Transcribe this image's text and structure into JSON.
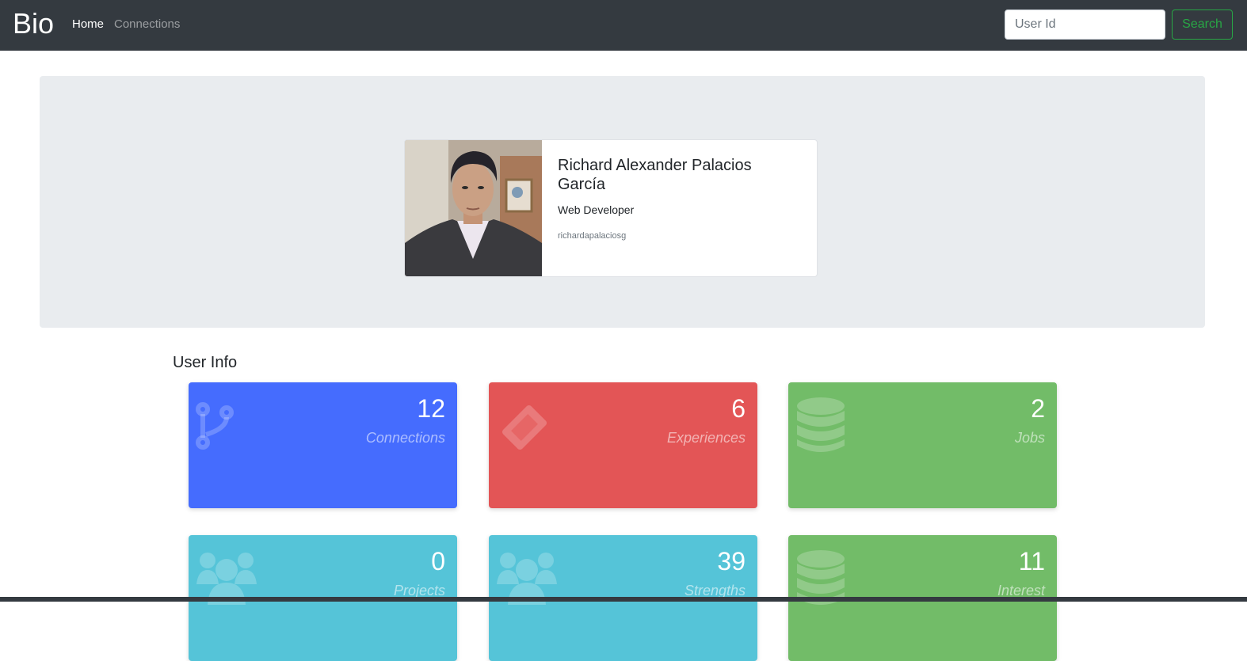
{
  "navbar": {
    "brand": "Bio",
    "links": [
      {
        "label": "Home",
        "active": true
      },
      {
        "label": "Connections",
        "active": false
      }
    ],
    "search": {
      "placeholder": "User Id",
      "value": "",
      "button_label": "Search"
    }
  },
  "profile": {
    "name": "Richard Alexander Palacios García",
    "role": "Web Developer",
    "username": "richardapalaciosg"
  },
  "user_info": {
    "title": "User Info",
    "stats": [
      {
        "value": "12",
        "label": "Connections",
        "color": "#456cfe",
        "icon": "fork-icon"
      },
      {
        "value": "6",
        "label": "Experiences",
        "color": "#e35556",
        "icon": "ticket-icon"
      },
      {
        "value": "2",
        "label": "Jobs",
        "color": "#72bc68",
        "icon": "database-icon"
      },
      {
        "value": "0",
        "label": "Projects",
        "color": "#55c4d8",
        "icon": "users-icon"
      },
      {
        "value": "39",
        "label": "Strengths",
        "color": "#55c4d8",
        "icon": "users-icon"
      },
      {
        "value": "11",
        "label": "Interest",
        "color": "#72bc68",
        "icon": "database-icon"
      }
    ]
  },
  "colors": {
    "navbar": "#343a40",
    "jumbotron": "#e9ecef",
    "search_accent": "#28a745"
  }
}
